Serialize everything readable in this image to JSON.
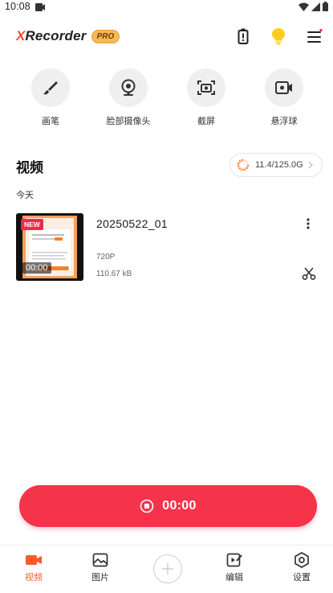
{
  "status_bar": {
    "time": "10:08"
  },
  "header": {
    "brand_prefix": "X",
    "brand_rest": "Recorder",
    "pro_badge": "PRO",
    "accent_color": "#ff4a2b"
  },
  "tools": [
    {
      "label": "画笔",
      "icon": "brush-icon"
    },
    {
      "label": "脸部摄像头",
      "icon": "webcam-icon"
    },
    {
      "label": "截屏",
      "icon": "screenshot-icon"
    },
    {
      "label": "悬浮球",
      "icon": "floating-ball-icon"
    }
  ],
  "videos": {
    "section_title": "视频",
    "storage": "11.4/125.0G",
    "group_label": "今天",
    "items": [
      {
        "title": "20250522_01",
        "resolution": "720P",
        "size": "110.67 kB",
        "duration": "00:00",
        "badge": "NEW"
      }
    ]
  },
  "record": {
    "time": "00:00",
    "color": "#f5334a"
  },
  "bottom_nav": {
    "items": [
      {
        "label": "视频",
        "icon": "video-icon",
        "active": true
      },
      {
        "label": "图片",
        "icon": "image-icon",
        "active": false
      },
      {
        "label": "编辑",
        "icon": "edit-icon",
        "active": false
      },
      {
        "label": "设置",
        "icon": "settings-icon",
        "active": false
      }
    ],
    "active_color": "#ff5a2a"
  }
}
